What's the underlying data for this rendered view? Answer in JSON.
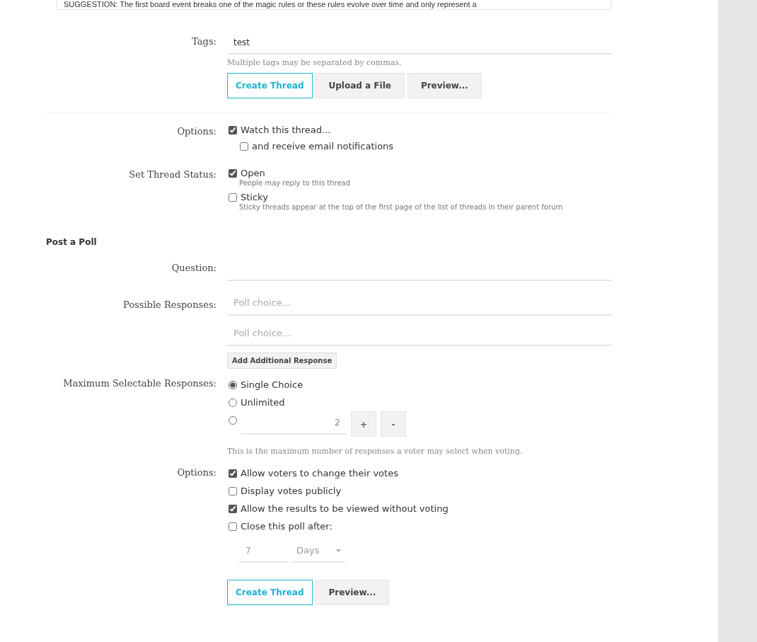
{
  "editor_excerpt": "SUGGESTION: The first board event breaks one of the magic rules or these rules evolve over time and only represent a",
  "tags": {
    "label": "Tags:",
    "value": "test",
    "hint": "Multiple tags may be separated by commas."
  },
  "top_buttons": [
    {
      "label": "Create Thread",
      "kind": "primary"
    },
    {
      "label": "Upload a File",
      "kind": "secondary"
    },
    {
      "label": "Preview...",
      "kind": "secondary"
    }
  ],
  "options": {
    "label": "Options:",
    "items": [
      {
        "label": "Watch this thread...",
        "checked": true,
        "children": [
          {
            "label": "and receive email notifications",
            "checked": false
          }
        ]
      }
    ]
  },
  "thread_status": {
    "label": "Set Thread Status:",
    "items": [
      {
        "label": "Open",
        "checked": true,
        "hint": "People may reply to this thread"
      },
      {
        "label": "Sticky",
        "checked": false,
        "hint": "Sticky threads appear at the top of the first page of the list of threads in their parent forum"
      }
    ]
  },
  "poll": {
    "title": "Post a Poll",
    "question_label": "Question:",
    "responses_label": "Possible Responses:",
    "responses": [
      {
        "placeholder": "Poll choice..."
      },
      {
        "placeholder": "Poll choice..."
      }
    ],
    "add_button": "Add Additional Response",
    "max_label": "Maximum Selectable Responses:",
    "max_choices": [
      {
        "kind": "label",
        "label": "Single Choice",
        "selected": true
      },
      {
        "kind": "label",
        "label": "Unlimited",
        "selected": false
      },
      {
        "kind": "number",
        "value": "2",
        "selected": false
      }
    ],
    "stepper": [
      "+",
      "-"
    ],
    "max_hint": "This is the maximum number of responses a voter may select when voting.",
    "options_label": "Options:",
    "options": [
      {
        "label": "Allow voters to change their votes",
        "checked": true
      },
      {
        "label": "Display votes publicly",
        "checked": false
      },
      {
        "label": "Allow the results to be viewed without voting",
        "checked": true
      },
      {
        "label": "Close this poll after:",
        "checked": false
      }
    ],
    "close_after": {
      "value": "7",
      "unit": "Days",
      "disabled": true
    }
  },
  "bottom_buttons": [
    {
      "label": "Create Thread",
      "kind": "primary"
    },
    {
      "label": "Preview...",
      "kind": "secondary"
    }
  ]
}
